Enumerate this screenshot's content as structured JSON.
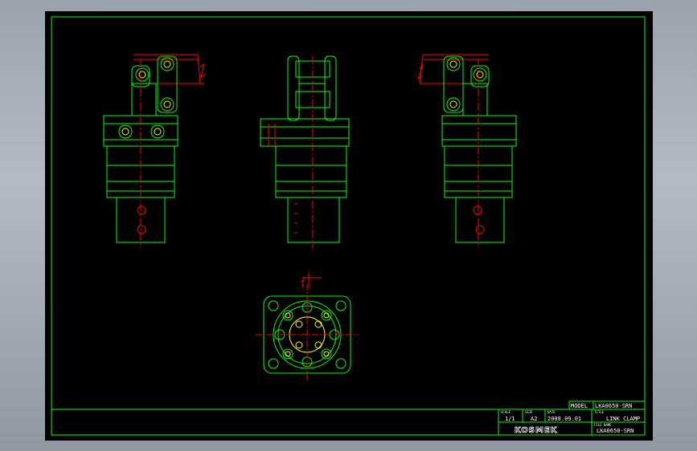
{
  "title_block": {
    "model_label": "MODEL",
    "model_value": "LKA0650-SRN",
    "scale_label": "SCALE",
    "scale_value": "1/1",
    "size_label": "SIZE",
    "size_value": "A2",
    "date_label": "DATE",
    "date_value": "2008.09.01",
    "title_label": "TITLE",
    "title_value": "LINK CLAMP",
    "file_label": "FILE NAME",
    "file_value": "LKA0650-SRN",
    "logo": "KOSMEK"
  },
  "colors": {
    "background": "#000000",
    "outline": "#00ff00",
    "centerline": "#ff0000",
    "dimension": "#ff0000",
    "hole": "#ffff00",
    "text": "#ffffff"
  }
}
